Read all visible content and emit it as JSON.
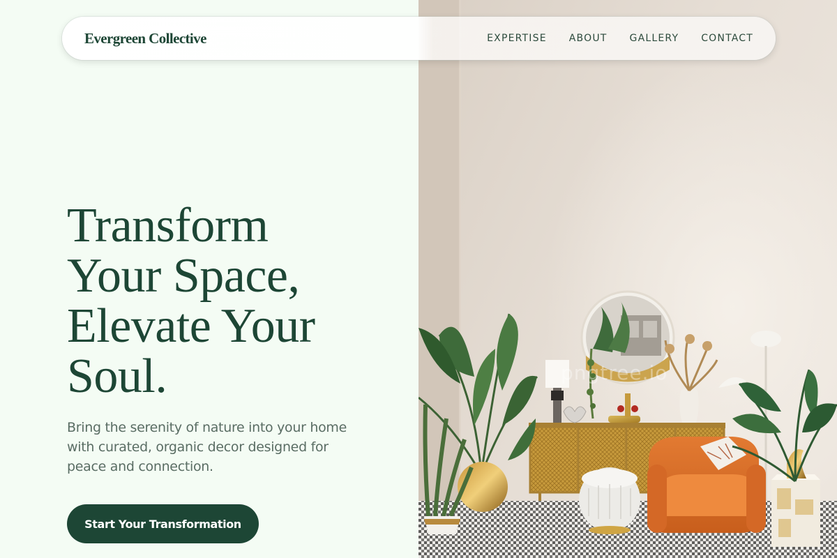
{
  "header": {
    "brand": "Evergreen Collective",
    "nav": [
      {
        "label": "EXPERTISE"
      },
      {
        "label": "ABOUT"
      },
      {
        "label": "GALLERY"
      },
      {
        "label": "CONTACT"
      }
    ]
  },
  "hero": {
    "title_lines": [
      "Transform",
      "Your Space,",
      "Elevate Your",
      "Soul."
    ],
    "subtitle_lines": [
      "Bring the serenity of nature into your home",
      "with curated, organic decor designed for",
      "peace and connection."
    ],
    "cta_label": "Start Your Transformation"
  },
  "photo": {
    "watermark": "pngtree.io"
  },
  "colors": {
    "brand_green": "#1d4635",
    "background": "#f4fcf4",
    "subtitle_gray": "#5a6d64"
  }
}
